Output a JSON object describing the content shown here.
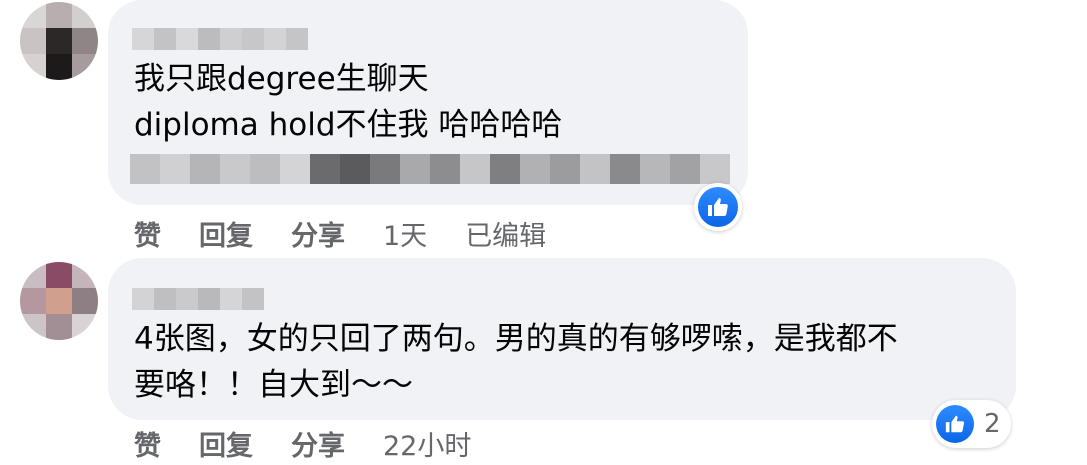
{
  "comments": [
    {
      "author_blurred": true,
      "text_lines": [
        "我只跟degree生聊天",
        "diploma hold不住我 哈哈哈哈"
      ],
      "actions": {
        "like": "赞",
        "reply": "回复",
        "share": "分享"
      },
      "time": "1天",
      "edited": "已编辑",
      "reaction": {
        "type": "like-icon",
        "count": ""
      }
    },
    {
      "author_blurred": true,
      "text_lines": [
        "4张图，女的只回了两句。男的真的有够啰嗦，是我都不",
        "要咯！！自大到～～"
      ],
      "actions": {
        "like": "赞",
        "reply": "回复",
        "share": "分享"
      },
      "time": "22小时",
      "reaction": {
        "type": "like-icon",
        "count": "2"
      }
    }
  ],
  "colors": {
    "bubble": "#f0f2f5",
    "like_blue": "#1877f2",
    "meta_gray": "#65676b",
    "text": "#050505"
  }
}
